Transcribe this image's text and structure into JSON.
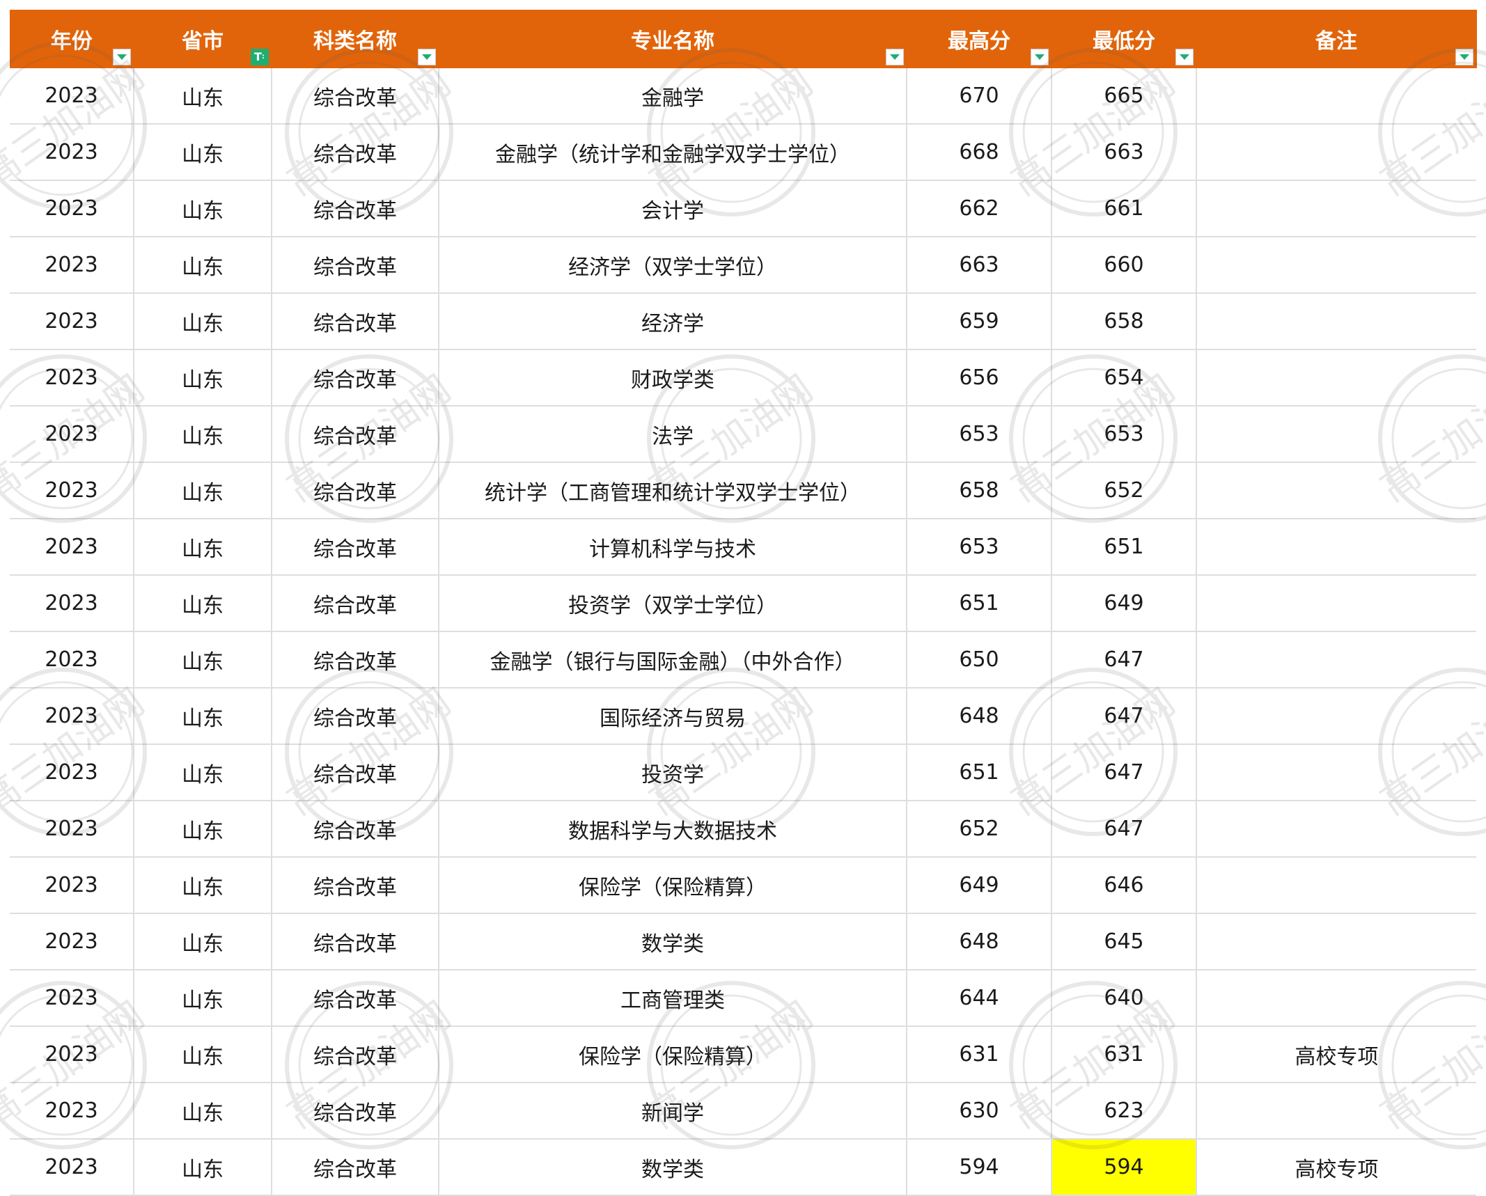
{
  "table": {
    "headers": [
      "年份",
      "省市",
      "科类名称",
      "专业名称",
      "最高分",
      "最低分",
      "备注"
    ],
    "rows": [
      {
        "year": "2023",
        "province": "山东",
        "category": "综合改革",
        "major": "金融学",
        "max": "670",
        "min": "665",
        "note": ""
      },
      {
        "year": "2023",
        "province": "山东",
        "category": "综合改革",
        "major": "金融学（统计学和金融学双学士学位）",
        "max": "668",
        "min": "663",
        "note": ""
      },
      {
        "year": "2023",
        "province": "山东",
        "category": "综合改革",
        "major": "会计学",
        "max": "662",
        "min": "661",
        "note": ""
      },
      {
        "year": "2023",
        "province": "山东",
        "category": "综合改革",
        "major": "经济学（双学士学位）",
        "max": "663",
        "min": "660",
        "note": ""
      },
      {
        "year": "2023",
        "province": "山东",
        "category": "综合改革",
        "major": "经济学",
        "max": "659",
        "min": "658",
        "note": ""
      },
      {
        "year": "2023",
        "province": "山东",
        "category": "综合改革",
        "major": "财政学类",
        "max": "656",
        "min": "654",
        "note": ""
      },
      {
        "year": "2023",
        "province": "山东",
        "category": "综合改革",
        "major": "法学",
        "max": "653",
        "min": "653",
        "note": ""
      },
      {
        "year": "2023",
        "province": "山东",
        "category": "综合改革",
        "major": "统计学（工商管理和统计学双学士学位）",
        "max": "658",
        "min": "652",
        "note": ""
      },
      {
        "year": "2023",
        "province": "山东",
        "category": "综合改革",
        "major": "计算机科学与技术",
        "max": "653",
        "min": "651",
        "note": ""
      },
      {
        "year": "2023",
        "province": "山东",
        "category": "综合改革",
        "major": "投资学（双学士学位）",
        "max": "651",
        "min": "649",
        "note": ""
      },
      {
        "year": "2023",
        "province": "山东",
        "category": "综合改革",
        "major": "金融学（银行与国际金融）（中外合作）",
        "max": "650",
        "min": "647",
        "note": ""
      },
      {
        "year": "2023",
        "province": "山东",
        "category": "综合改革",
        "major": "国际经济与贸易",
        "max": "648",
        "min": "647",
        "note": ""
      },
      {
        "year": "2023",
        "province": "山东",
        "category": "综合改革",
        "major": "投资学",
        "max": "651",
        "min": "647",
        "note": ""
      },
      {
        "year": "2023",
        "province": "山东",
        "category": "综合改革",
        "major": "数据科学与大数据技术",
        "max": "652",
        "min": "647",
        "note": ""
      },
      {
        "year": "2023",
        "province": "山东",
        "category": "综合改革",
        "major": "保险学（保险精算）",
        "max": "649",
        "min": "646",
        "note": ""
      },
      {
        "year": "2023",
        "province": "山东",
        "category": "综合改革",
        "major": "数学类",
        "max": "648",
        "min": "645",
        "note": ""
      },
      {
        "year": "2023",
        "province": "山东",
        "category": "综合改革",
        "major": "工商管理类",
        "max": "644",
        "min": "640",
        "note": ""
      },
      {
        "year": "2023",
        "province": "山东",
        "category": "综合改革",
        "major": "保险学（保险精算）",
        "max": "631",
        "min": "631",
        "note": "高校专项"
      },
      {
        "year": "2023",
        "province": "山东",
        "category": "综合改革",
        "major": "新闻学",
        "max": "630",
        "min": "623",
        "note": ""
      },
      {
        "year": "2023",
        "province": "山东",
        "category": "综合改革",
        "major": "数学类",
        "max": "594",
        "min": "594",
        "note": "高校专项",
        "highlight_min": true
      }
    ]
  },
  "watermark": {
    "text": "高三加油网"
  },
  "colors": {
    "header_bg": "#e2640a",
    "header_text": "#ffffff",
    "grid": "#dedede",
    "highlight": "#ffff00",
    "filter_active": "#1fae72"
  },
  "icons": {
    "filter": "dropdown-filter-icon",
    "filter_active": "active-filter-icon"
  }
}
